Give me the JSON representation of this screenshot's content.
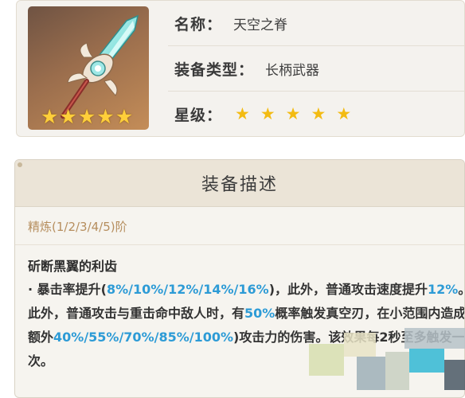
{
  "item": {
    "name_label": "名称：",
    "name_value": "天空之脊",
    "type_label": "装备类型：",
    "type_value": "长柄武器",
    "rarity_label": "星级：",
    "rarity_stars": 5
  },
  "description": {
    "header": "装备描述",
    "refinement": "精炼(1/2/3/4/5)阶",
    "effect_title": "斫断黑翼的利齿",
    "effect_parts": {
      "p1": "· 暴击率提升(",
      "h1": "8%/10%/12%/14%/16%",
      "p2": ")，此外，普通攻击速度提升",
      "h2": "12%",
      "p3": "。此外，普通攻击与重击命中敌人时，有",
      "h3": "50%",
      "p4": "概率触发真空刃，在小范围内造成额外",
      "h4": "40%/55%/70%/85%/100%",
      "p5": ")攻击力的伤害。该效果每2秒至多触发一次。"
    }
  },
  "colors": {
    "highlight": "#2d9bd6",
    "star_gold": "#f3bb12",
    "header_bg": "#ebe4d7"
  }
}
